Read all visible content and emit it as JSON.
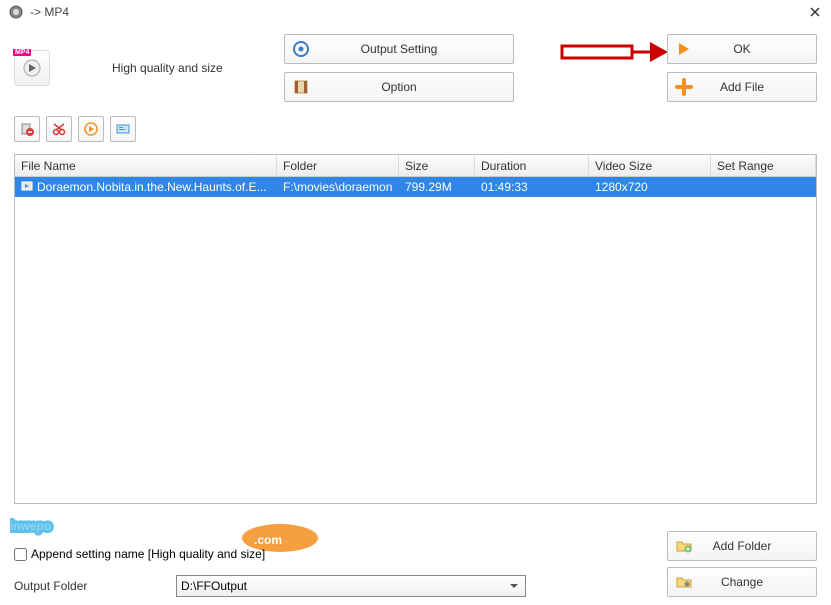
{
  "window": {
    "title": "-> MP4"
  },
  "top": {
    "format_badge": "MP4",
    "quality_text": "High quality and size",
    "output_setting_label": "Output Setting",
    "option_label": "Option",
    "ok_label": "OK",
    "add_file_label": "Add File"
  },
  "table": {
    "headers": {
      "file_name": "File Name",
      "folder": "Folder",
      "size": "Size",
      "duration": "Duration",
      "video_size": "Video Size",
      "set_range": "Set Range"
    },
    "rows": [
      {
        "file_name": "Doraemon.Nobita.in.the.New.Haunts.of.E...",
        "folder": "F:\\movies\\doraemon",
        "size": "799.29M",
        "duration": "01:49:33",
        "video_size": "1280x720",
        "set_range": ""
      }
    ]
  },
  "bottom": {
    "append_setting_label": "Append setting name [High quality and size]",
    "output_folder_label": "Output Folder",
    "output_folder_value": "D:\\FFOutput",
    "add_folder_label": "Add Folder",
    "change_label": "Change"
  }
}
